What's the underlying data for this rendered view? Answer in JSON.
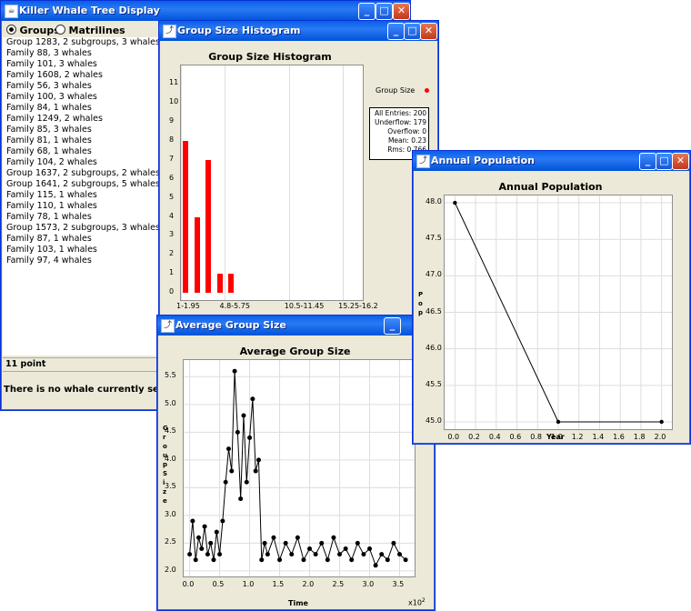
{
  "main_window": {
    "title": "Killer Whale Tree Display",
    "radio_groups": "Groups",
    "radio_matrilines": "Matrilines",
    "groups_selected": true,
    "list_items": [
      "Group 1283, 2 subgroups, 3 whales",
      "Family 88, 3 whales",
      "Family 101, 3 whales",
      "Family 1608, 2 whales",
      "Family 56, 3 whales",
      "Family 100, 3 whales",
      "Family 84, 1 whales",
      "Family 1249, 2 whales",
      "Family 85, 3 whales",
      "Family 81, 1 whales",
      "Family 68, 1 whales",
      "Family 104, 2 whales",
      "Group 1637, 2 subgroups, 2 whales",
      "Group 1641, 2 subgroups, 5 whales",
      "Family 115, 1 whales",
      "Family 110, 1 whales",
      "Family 78, 1 whales",
      "Group 1573, 2 subgroups, 3 whales",
      "Family 87, 1 whales",
      "Family 103, 1 whales",
      "Family 97, 4 whales"
    ],
    "status_label": "11 point",
    "selection_text": "There is no whale currently selected."
  },
  "histogram_window": {
    "title": "Group Size Histogram",
    "legend_label": "Group Size",
    "stats": [
      "All Entries: 200",
      "Underflow: 179",
      "Overflow: 0",
      "Mean: 0.23",
      "Rms: 0.766"
    ]
  },
  "avg_window": {
    "title": "Average Group Size",
    "exponent_label": "x10",
    "exponent_power": "2"
  },
  "annual_window": {
    "title": "Annual Population"
  },
  "chart_data": [
    {
      "type": "bar",
      "title": "Group Size Histogram",
      "series": [
        {
          "name": "Group Size",
          "color": "#ff0000"
        }
      ],
      "y_ticks": [
        "0",
        "1",
        "2",
        "3",
        "4",
        "5",
        "6",
        "7",
        "8",
        "9",
        "10",
        "11"
      ],
      "x_tick_labels": [
        "1-1.95",
        "4.8-5.75",
        "10.5-11.45",
        "15.25-16.2"
      ],
      "bins": [
        1,
        2,
        3,
        4,
        5
      ],
      "values": [
        8,
        4,
        7,
        1,
        1
      ],
      "ylim": [
        0,
        11.5
      ],
      "xlim": [
        1,
        17
      ]
    },
    {
      "type": "line",
      "title": "Average Group Size",
      "xlabel": "Time",
      "ylabel": "Group Size",
      "x_ticks": [
        "0.0",
        "0.5",
        "1.0",
        "1.5",
        "2.0",
        "2.5",
        "3.0",
        "3.5"
      ],
      "y_ticks": [
        "2.0",
        "2.5",
        "3.0",
        "3.5",
        "4.0",
        "4.5",
        "5.0",
        "5.5"
      ],
      "xlim": [
        -0.1,
        3.75
      ],
      "ylim": [
        1.9,
        5.8
      ],
      "x": [
        0.0,
        0.05,
        0.1,
        0.15,
        0.2,
        0.25,
        0.3,
        0.35,
        0.4,
        0.45,
        0.5,
        0.55,
        0.6,
        0.65,
        0.7,
        0.75,
        0.8,
        0.85,
        0.9,
        0.95,
        1.0,
        1.05,
        1.1,
        1.15,
        1.2,
        1.25,
        1.3,
        1.4,
        1.5,
        1.6,
        1.7,
        1.8,
        1.9,
        2.0,
        2.1,
        2.2,
        2.3,
        2.4,
        2.5,
        2.6,
        2.7,
        2.8,
        2.9,
        3.0,
        3.1,
        3.2,
        3.3,
        3.4,
        3.5,
        3.6
      ],
      "y": [
        2.3,
        2.9,
        2.2,
        2.6,
        2.4,
        2.8,
        2.3,
        2.5,
        2.2,
        2.7,
        2.3,
        2.9,
        3.6,
        4.2,
        3.8,
        5.6,
        4.5,
        3.3,
        4.8,
        3.6,
        4.4,
        5.1,
        3.8,
        4.0,
        2.2,
        2.5,
        2.3,
        2.6,
        2.2,
        2.5,
        2.3,
        2.6,
        2.2,
        2.4,
        2.3,
        2.5,
        2.2,
        2.6,
        2.3,
        2.4,
        2.2,
        2.5,
        2.3,
        2.4,
        2.1,
        2.3,
        2.2,
        2.5,
        2.3,
        2.2
      ]
    },
    {
      "type": "line",
      "title": "Annual Population",
      "xlabel": "Year",
      "ylabel": "Pop",
      "x": [
        0.0,
        1.0,
        2.0
      ],
      "y": [
        48.0,
        45.0,
        45.0
      ],
      "x_ticks": [
        "0.0",
        "0.2",
        "0.4",
        "0.6",
        "0.8",
        "1.0",
        "1.2",
        "1.4",
        "1.6",
        "1.8",
        "2.0"
      ],
      "y_ticks": [
        "45.0",
        "45.5",
        "46.0",
        "46.5",
        "47.0",
        "47.5",
        "48.0"
      ],
      "xlim": [
        -0.1,
        2.1
      ],
      "ylim": [
        44.9,
        48.1
      ]
    }
  ]
}
